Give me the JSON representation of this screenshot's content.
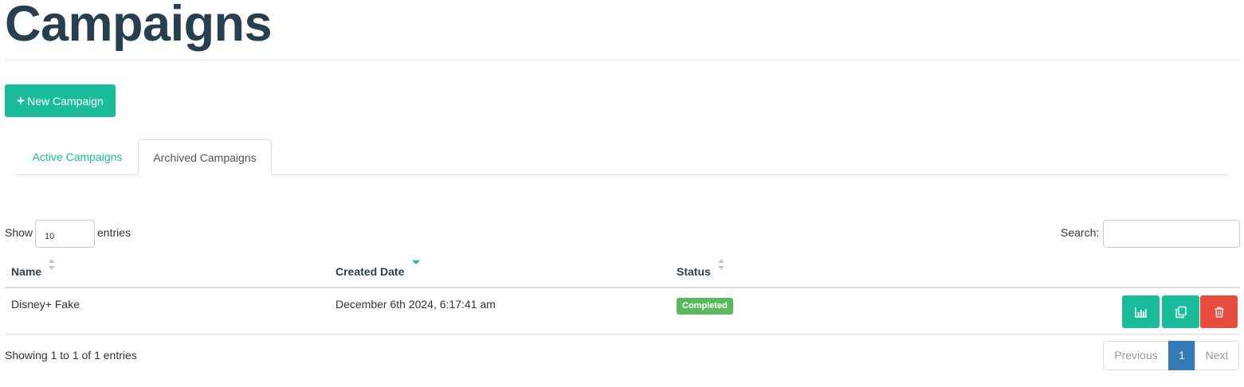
{
  "page": {
    "title": "Campaigns"
  },
  "toolbar": {
    "new_campaign_label": "New Campaign",
    "new_campaign_icon": "plus-icon"
  },
  "tabs": [
    {
      "label": "Active Campaigns",
      "selected": false
    },
    {
      "label": "Archived Campaigns",
      "selected": true
    }
  ],
  "table_controls": {
    "show_label": "Show",
    "page_length": "10",
    "entries_label": "entries",
    "search_label": "Search:",
    "search_value": ""
  },
  "table": {
    "columns": [
      {
        "label": "Name",
        "sort": "none"
      },
      {
        "label": "Created Date",
        "sort": "descending"
      },
      {
        "label": "Status",
        "sort": "none"
      }
    ],
    "rows": [
      {
        "name": "Disney+ Fake",
        "created_date": "December 6th 2024, 6:17:41 am",
        "status": "Completed",
        "actions": [
          "results-chart-icon",
          "copy-icon",
          "trash-icon"
        ]
      }
    ]
  },
  "footer": {
    "info": "Showing 1 to 1 of 1 entries",
    "previous_label": "Previous",
    "current_page": "1",
    "next_label": "Next"
  },
  "colors": {
    "title": "#283f50",
    "accent": "#1abc9c",
    "danger": "#e74c3c",
    "success_badge": "#5cb85c",
    "page_active": "#337ab7"
  }
}
